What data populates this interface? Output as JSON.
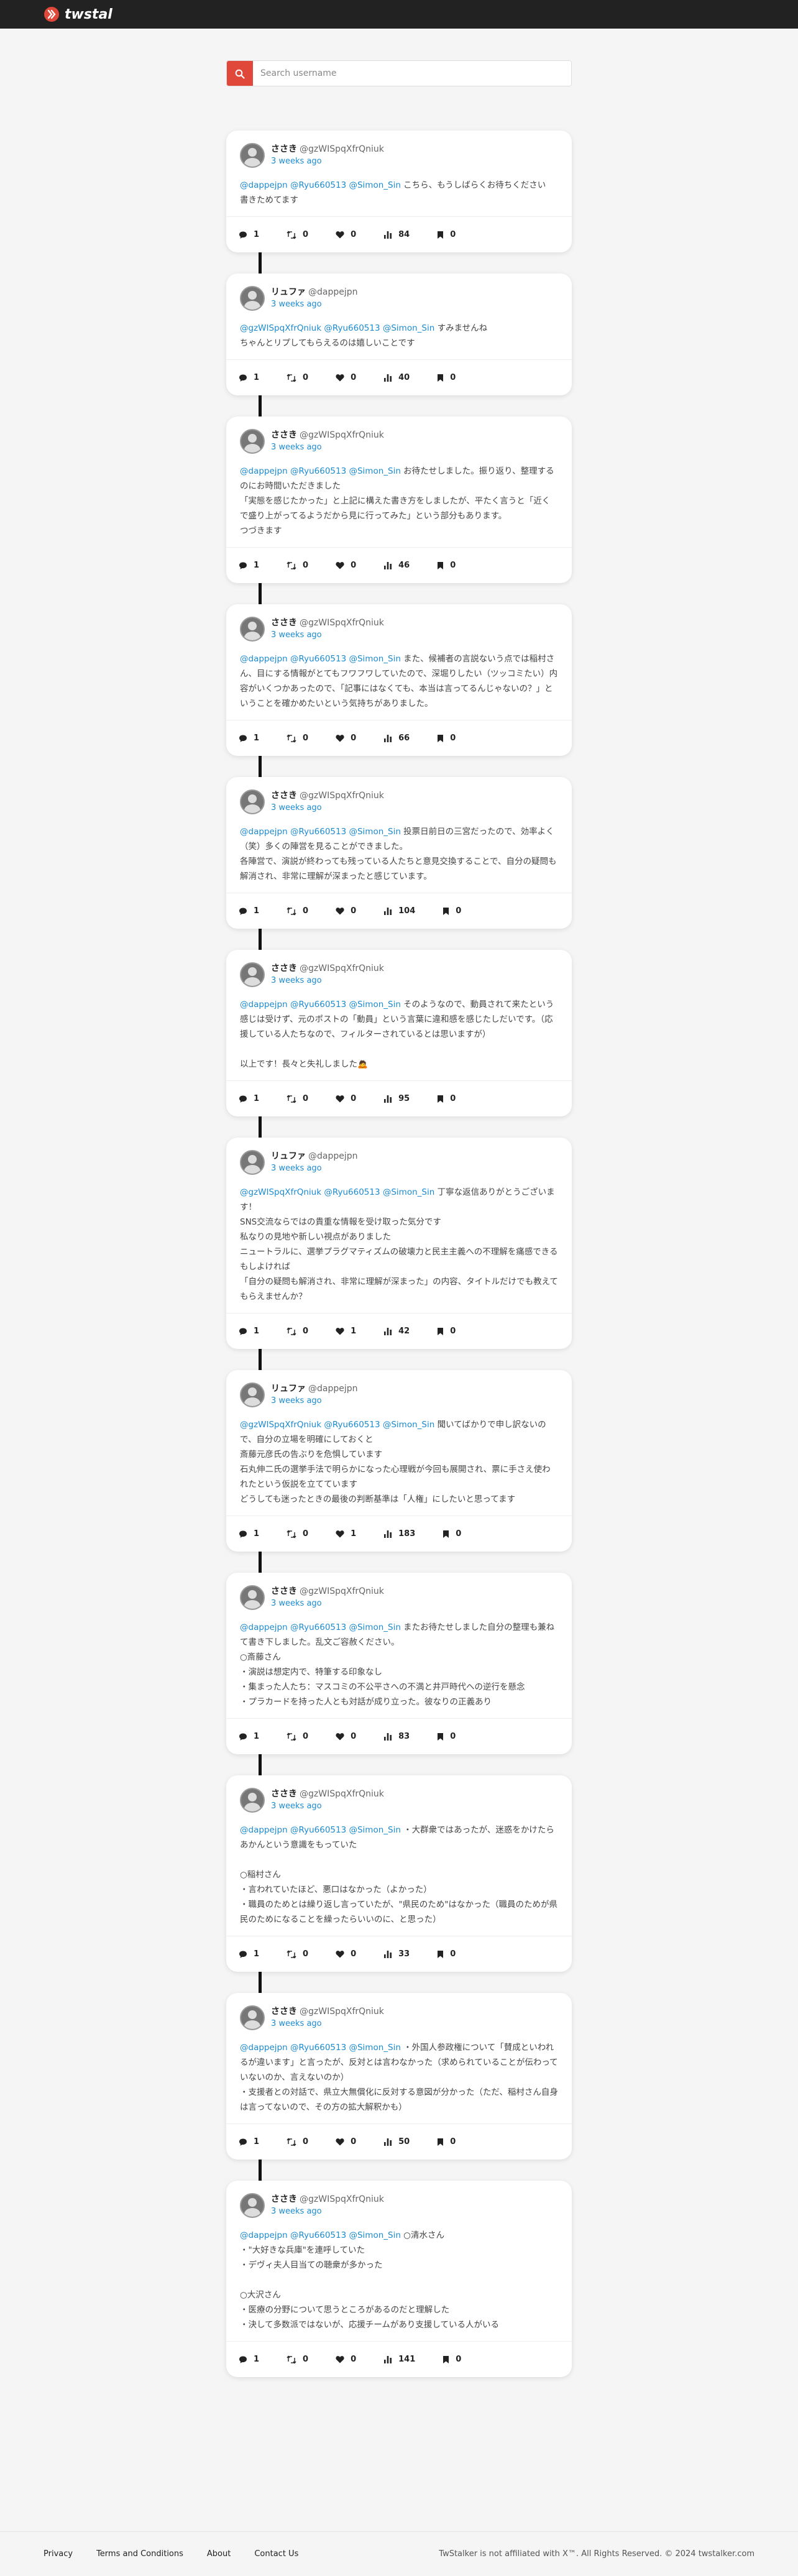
{
  "app": {
    "name": "twstal",
    "brand_color": "#e0483a"
  },
  "search": {
    "placeholder": "Search username",
    "icon": "search-icon"
  },
  "tweets": [
    {
      "name": "ささき",
      "handle": "@gzWISpqXfrQniuk",
      "time": "3 weeks ago",
      "mentions": "@dappejpn @Ryu660513 @Simon_Sin",
      "text": " こちら、もうしばらくお待ちください\n書きためてます",
      "replies": "1",
      "retweets": "0",
      "likes": "0",
      "views": "84",
      "bookmarks": "0"
    },
    {
      "name": "リュファ",
      "handle": "@dappejpn",
      "time": "3 weeks ago",
      "mentions": "@gzWISpqXfrQniuk @Ryu660513 @Simon_Sin",
      "text": " すみませんね\nちゃんとリプしてもらえるのは嬉しいことです",
      "replies": "1",
      "retweets": "0",
      "likes": "0",
      "views": "40",
      "bookmarks": "0"
    },
    {
      "name": "ささき",
      "handle": "@gzWISpqXfrQniuk",
      "time": "3 weeks ago",
      "mentions": "@dappejpn @Ryu660513 @Simon_Sin",
      "text": " お待たせしました。振り返り、整理するのにお時間いただきました\n「実態を感じたかった」と上記に構えた書き方をしましたが、平たく言うと「近くで盛り上がってるようだから見に行ってみた」という部分もあります。\nつづきます",
      "replies": "1",
      "retweets": "0",
      "likes": "0",
      "views": "46",
      "bookmarks": "0"
    },
    {
      "name": "ささき",
      "handle": "@gzWISpqXfrQniuk",
      "time": "3 weeks ago",
      "mentions": "@dappejpn @Ryu660513 @Simon_Sin",
      "text": " また、候補者の言説ないう点では稲村さん、目にする情報がとてもフワフワしていたので、深堀りしたい（ツッコミたい）内容がいくつかあったので、「記事にはなくても、本当は言ってるんじゃないの？」ということを確かめたいという気持ちがありました。",
      "replies": "1",
      "retweets": "0",
      "likes": "0",
      "views": "66",
      "bookmarks": "0"
    },
    {
      "name": "ささき",
      "handle": "@gzWISpqXfrQniuk",
      "time": "3 weeks ago",
      "mentions": "@dappejpn @Ryu660513 @Simon_Sin",
      "text": " 投票日前日の三宮だったので、効率よく（笑）多くの陣営を見ることができました。\n各陣営で、演説が終わっても残っている人たちと意見交換することで、自分の疑問も解消され、非常に理解が深まったと感じています。",
      "replies": "1",
      "retweets": "0",
      "likes": "0",
      "views": "104",
      "bookmarks": "0"
    },
    {
      "name": "ささき",
      "handle": "@gzWISpqXfrQniuk",
      "time": "3 weeks ago",
      "mentions": "@dappejpn @Ryu660513 @Simon_Sin",
      "text": " そのようなので、動員されて来たという感じは受けず、元のポストの「動員」という言葉に違和感を感じたしだいです。（応援している人たちなので、フィルターされているとは思いますが）\n\n以上です！長々と失礼しました🙇",
      "replies": "1",
      "retweets": "0",
      "likes": "0",
      "views": "95",
      "bookmarks": "0"
    },
    {
      "name": "リュファ",
      "handle": "@dappejpn",
      "time": "3 weeks ago",
      "mentions": "@gzWISpqXfrQniuk @Ryu660513 @Simon_Sin",
      "text": " 丁寧な返信ありがとうございます！\nSNS交流ならではの貴重な情報を受け取った気分です\n私なりの見地や新しい視点がありました\nニュートラルに、選挙プラグマティズムの破壊力と民主主義への不理解を痛感できるもしよければ\n「自分の疑問も解消され、非常に理解が深まった」の内容、タイトルだけでも教えてもらえませんか？",
      "replies": "1",
      "retweets": "0",
      "likes": "1",
      "views": "42",
      "bookmarks": "0"
    },
    {
      "name": "リュファ",
      "handle": "@dappejpn",
      "time": "3 weeks ago",
      "mentions": "@gzWISpqXfrQniuk @Ryu660513 @Simon_Sin",
      "text": " 聞いてばかりで申し訳ないので、自分の立場を明確にしておくと\n斎藤元彦氏の告ぶりを危惧しています\n石丸伸二氏の選挙手法で明らかになった心理戦が今回も展開され、票に手さえ使われたという仮説を立てています\nどうしても迷ったときの最後の判断基準は「人権」にしたいと思ってます",
      "replies": "1",
      "retweets": "0",
      "likes": "1",
      "views": "183",
      "bookmarks": "0"
    },
    {
      "name": "ささき",
      "handle": "@gzWISpqXfrQniuk",
      "time": "3 weeks ago",
      "mentions": "@dappejpn @Ryu660513 @Simon_Sin",
      "text": " またお待たせしました自分の整理も兼ねて書き下しました。乱文ご容赦ください。\n○斎藤さん\n・演説は想定内で、特筆する印象なし\n・集まった人たち：マスコミの不公平さへの不満と井戸時代への逆行を懸念\n・プラカードを持った人とも対話が成り立った。彼なりの正義あり",
      "replies": "1",
      "retweets": "0",
      "likes": "0",
      "views": "83",
      "bookmarks": "0"
    },
    {
      "name": "ささき",
      "handle": "@gzWISpqXfrQniuk",
      "time": "3 weeks ago",
      "mentions": "@dappejpn @Ryu660513 @Simon_Sin",
      "text": " ・大群衆ではあったが、迷惑をかけたらあかんという意識をもっていた\n\n○稲村さん\n・言われていたほど、悪口はなかった（よかった）\n・職員のためとは繰り返し言っていたが、\"県民のため\"はなかった（職員のためが県民のためになることを繰ったらいいのに、と思った）",
      "replies": "1",
      "retweets": "0",
      "likes": "0",
      "views": "33",
      "bookmarks": "0"
    },
    {
      "name": "ささき",
      "handle": "@gzWISpqXfrQniuk",
      "time": "3 weeks ago",
      "mentions": "@dappejpn @Ryu660513 @Simon_Sin",
      "text": " ・外国人参政権について「賛成といわれるが違います」と言ったが、反対とは言わなかった（求められていることが伝わっていないのか、言えないのか）\n・支援者との対話で、県立大無償化に反対する意図が分かった（ただ、稲村さん自身は言ってないので、その方の拡大解釈かも）",
      "replies": "1",
      "retweets": "0",
      "likes": "0",
      "views": "50",
      "bookmarks": "0"
    },
    {
      "name": "ささき",
      "handle": "@gzWISpqXfrQniuk",
      "time": "3 weeks ago",
      "mentions": "@dappejpn @Ryu660513 @Simon_Sin",
      "text": " ○清水さん\n・\"大好きな兵庫\"を連呼していた\n・デヴィ夫人目当ての聴衆が多かった\n\n○大沢さん\n・医療の分野について思うところがあるのだと理解した\n・決して多数派ではないが、応援チームがあり支援している人がいる",
      "replies": "1",
      "retweets": "0",
      "likes": "0",
      "views": "141",
      "bookmarks": "0"
    }
  ],
  "footer": {
    "links": [
      "Privacy",
      "Terms and Conditions",
      "About",
      "Contact Us"
    ],
    "copyright": "TwStalker is not affiliated with X™. All Rights Reserved. © 2024 twstalker.com"
  }
}
